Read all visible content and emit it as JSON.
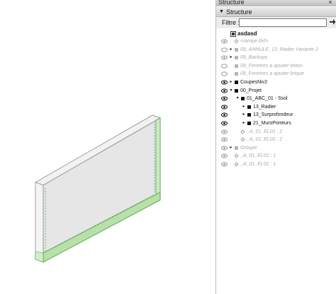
{
  "window": {
    "title": "Structure",
    "close": "×"
  },
  "panel": {
    "header": "Structure",
    "filter_label": "Filtre :",
    "filter_value": "",
    "filter_go_icon": "arrow-right-icon"
  },
  "tree": {
    "root": {
      "label": "asdasd",
      "icon": "model-icon"
    },
    "items": [
      {
        "label": "<rampe.dxf>",
        "visible": true,
        "expand": "",
        "kind": "component-grey",
        "indent": 0,
        "dim": true
      },
      {
        "label": "09_ANNULE_13_Radier Variante 2",
        "visible": false,
        "expand": "▸",
        "kind": "grey",
        "indent": 0,
        "dim": true
      },
      {
        "label": "09_Backups",
        "visible": true,
        "expand": "▸",
        "kind": "grey",
        "indent": 0,
        "dim": true
      },
      {
        "label": "09_Fenetres a ajouter beton",
        "visible": false,
        "expand": "",
        "kind": "grey",
        "indent": 0,
        "dim": true
      },
      {
        "label": "09_Fenetres a ajouter brique",
        "visible": false,
        "expand": "",
        "kind": "grey",
        "indent": 0,
        "dim": true
      },
      {
        "label": "CoupesNiv2",
        "visible": true,
        "expand": "▸",
        "kind": "black",
        "indent": 0,
        "dim": false
      },
      {
        "label": "00_Projet",
        "visible": true,
        "expand": "▾",
        "kind": "black",
        "indent": 0,
        "dim": false
      },
      {
        "label": "01_ABC_01 - Ssol",
        "visible": true,
        "expand": "▾",
        "kind": "black",
        "indent": 1,
        "dim": false
      },
      {
        "label": "13_Radier",
        "visible": true,
        "expand": "▸",
        "kind": "black",
        "indent": 2,
        "dim": false
      },
      {
        "label": "13_Surprofondeur",
        "visible": true,
        "expand": "▸",
        "kind": "black",
        "indent": 2,
        "dim": false
      },
      {
        "label": "21_MursPorteurs",
        "visible": true,
        "expand": "▸",
        "kind": "black",
        "indent": 2,
        "dim": false
      },
      {
        "label": "_A_01_EL01 : 2",
        "visible": true,
        "expand": "",
        "kind": "component",
        "indent": 1,
        "dim": true
      },
      {
        "label": "_A_01_EL02 : 2",
        "visible": true,
        "expand": "",
        "kind": "component",
        "indent": 1,
        "dim": true
      },
      {
        "label": "Groupe",
        "visible": true,
        "expand": "▸",
        "kind": "grey",
        "indent": 0,
        "dim": true
      },
      {
        "label": "_A_01_EL01 : 1",
        "visible": true,
        "expand": "",
        "kind": "component",
        "indent": 0,
        "dim": true
      },
      {
        "label": "_A_01_EL02 : 1",
        "visible": true,
        "expand": "",
        "kind": "component",
        "indent": 0,
        "dim": true
      }
    ]
  },
  "colors": {
    "wall_face": "#e6e6e6",
    "wall_edge": "#8a8a8a",
    "wall_slab": "#b8e0a8",
    "guide_green": "#3faa3f"
  }
}
